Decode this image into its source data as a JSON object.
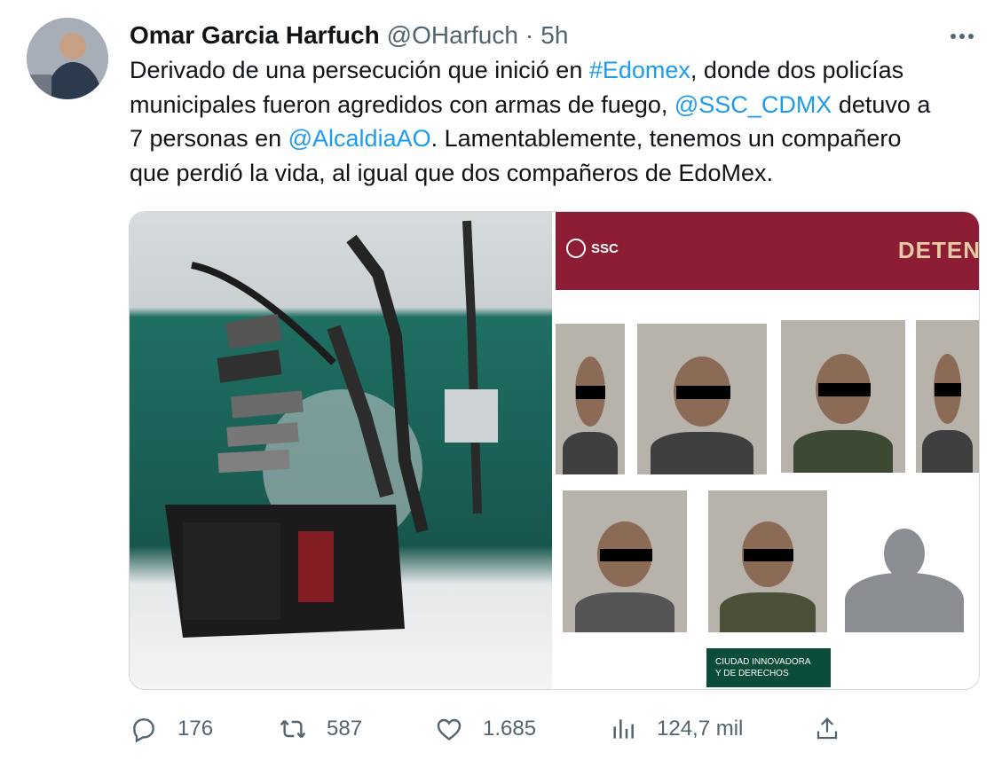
{
  "author": {
    "name": "Omar Garcia Harfuch",
    "handle": "@OHarfuch",
    "separator": "·",
    "time": "5h"
  },
  "tweet": {
    "lines": [
      [
        {
          "text": "Derivado de una persecución que inició en ",
          "link": false
        },
        {
          "text": "#Edomex",
          "link": true
        },
        {
          "text": ", donde dos policías",
          "link": false
        }
      ],
      [
        {
          "text": "municipales fueron agredidos con armas de fuego, ",
          "link": false
        },
        {
          "text": "@SSC_CDMX",
          "link": true
        },
        {
          "text": " detuvo a",
          "link": false
        }
      ],
      [
        {
          "text": "7 personas en ",
          "link": false
        },
        {
          "text": "@AlcaldiaAO",
          "link": true
        },
        {
          "text": ". Lamentablemente, tenemos un compañero",
          "link": false
        }
      ],
      [
        {
          "text": "que perdió la vida, al igual que dos compañeros de EdoMex.",
          "link": false
        }
      ]
    ]
  },
  "media": {
    "banner_logo": "SSC",
    "banner_title": "DETEN",
    "footer_badge": {
      "line1": "CIUDAD INNOVADORA",
      "line2": "Y DE DERECHOS"
    }
  },
  "actions": {
    "replies": "176",
    "retweets": "587",
    "likes": "1.685",
    "views": "124,7 mil"
  },
  "icons": [
    "more-icon",
    "reply-icon",
    "retweet-icon",
    "like-icon",
    "views-icon",
    "share-icon"
  ],
  "colors": {
    "link": "#1d9bf0",
    "muted": "#536471",
    "banner": "#8c1d35"
  }
}
